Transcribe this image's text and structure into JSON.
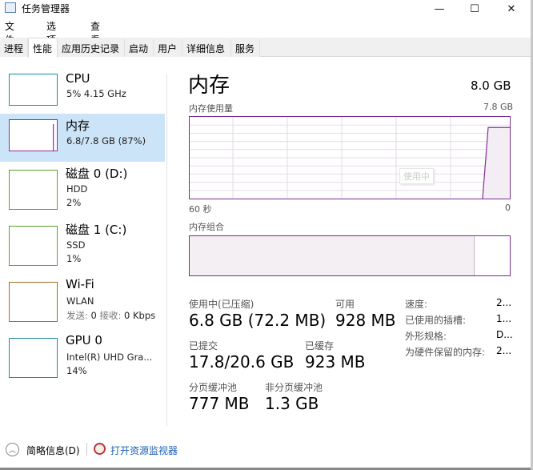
{
  "window": {
    "title": "任务管理器",
    "controls": {
      "minimize": "—",
      "maximize": "☐",
      "close": "✕"
    }
  },
  "menu": [
    "文件(F)",
    "选项(O)",
    "查看(V)"
  ],
  "tabs": [
    {
      "label": "进程"
    },
    {
      "label": "性能",
      "active": true
    },
    {
      "label": "应用历史记录"
    },
    {
      "label": "启动"
    },
    {
      "label": "用户"
    },
    {
      "label": "详细信息"
    },
    {
      "label": "服务"
    }
  ],
  "sidebar": {
    "items": [
      {
        "name": "CPU",
        "line1": "5% 4.15 GHz",
        "line2": "",
        "color": "#1a8c9c"
      },
      {
        "name": "内存",
        "line1": "6.8/7.8 GB (87%)",
        "line2": "",
        "color": "#8b2a9e",
        "selected": true
      },
      {
        "name": "磁盘 0 (D:)",
        "line1": "HDD",
        "line2": "2%",
        "color": "#5aa02c"
      },
      {
        "name": "磁盘 1 (C:)",
        "line1": "SSD",
        "line2": "1%",
        "color": "#5aa02c"
      },
      {
        "name": "Wi-Fi",
        "line1": "WLAN",
        "line2_label1": "发送:",
        "line2_val1": "0",
        "line2_label2": "接收:",
        "line2_val2": "0 Kbps",
        "color": "#a46c2a"
      },
      {
        "name": "GPU 0",
        "line1": "Intel(R) UHD Gra...",
        "line2": "14%",
        "color": "#1a8c9c"
      }
    ]
  },
  "main": {
    "title": "内存",
    "total": "8.0 GB",
    "usage_label": "内存使用量",
    "usage_max": "7.8 GB",
    "graph": {
      "x_left": "60 秒",
      "x_right": "0",
      "tooltip": "使用中",
      "recent_usage_percent": 87,
      "color": "#8b2a9e"
    },
    "composition_label": "内存组合",
    "composition": {
      "in_use_percent": 89
    },
    "stats": {
      "in_use_label": "使用中(已压缩)",
      "in_use_value": "6.8 GB (72.2 MB)",
      "available_label": "可用",
      "available_value": "928 MB",
      "committed_label": "已提交",
      "committed_value": "17.8/20.6 GB",
      "cached_label": "已缓存",
      "cached_value": "923 MB",
      "paged_label": "分页缓冲池",
      "paged_value": "777 MB",
      "nonpaged_label": "非分页缓冲池",
      "nonpaged_value": "1.3 GB"
    },
    "specs": [
      {
        "label": "速度:",
        "value": "2..."
      },
      {
        "label": "已使用的插槽:",
        "value": "1..."
      },
      {
        "label": "外形规格:",
        "value": "D..."
      },
      {
        "label": "为硬件保留的内存:",
        "value": "2..."
      }
    ]
  },
  "footer": {
    "brief_label": "简略信息(D)",
    "monitor_link": "打开资源监视器"
  }
}
